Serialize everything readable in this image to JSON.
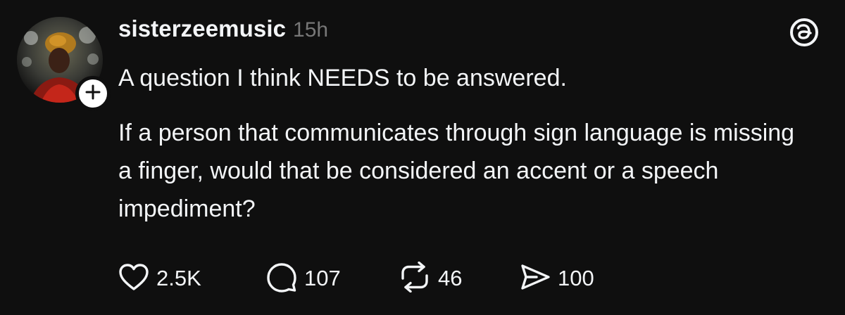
{
  "post": {
    "username": "sisterzeemusic",
    "timestamp": "15h",
    "text_line1": "A question I think NEEDS to be answered.",
    "text_para2": "If a person that communicates through sign language is missing a finger, would that be considered an accent or a speech impediment?",
    "likes": "2.5K",
    "replies": "107",
    "reposts": "46",
    "shares": "100"
  },
  "icons": {
    "avatar": "avatar",
    "follow": "plus-icon",
    "app_logo": "threads-logo-icon",
    "like": "heart-icon",
    "reply": "speech-bubble-icon",
    "repost": "repost-icon",
    "share": "send-icon"
  },
  "colors": {
    "background": "#0f0f0f",
    "text": "#f3f5f7",
    "secondary_text": "#777777"
  }
}
